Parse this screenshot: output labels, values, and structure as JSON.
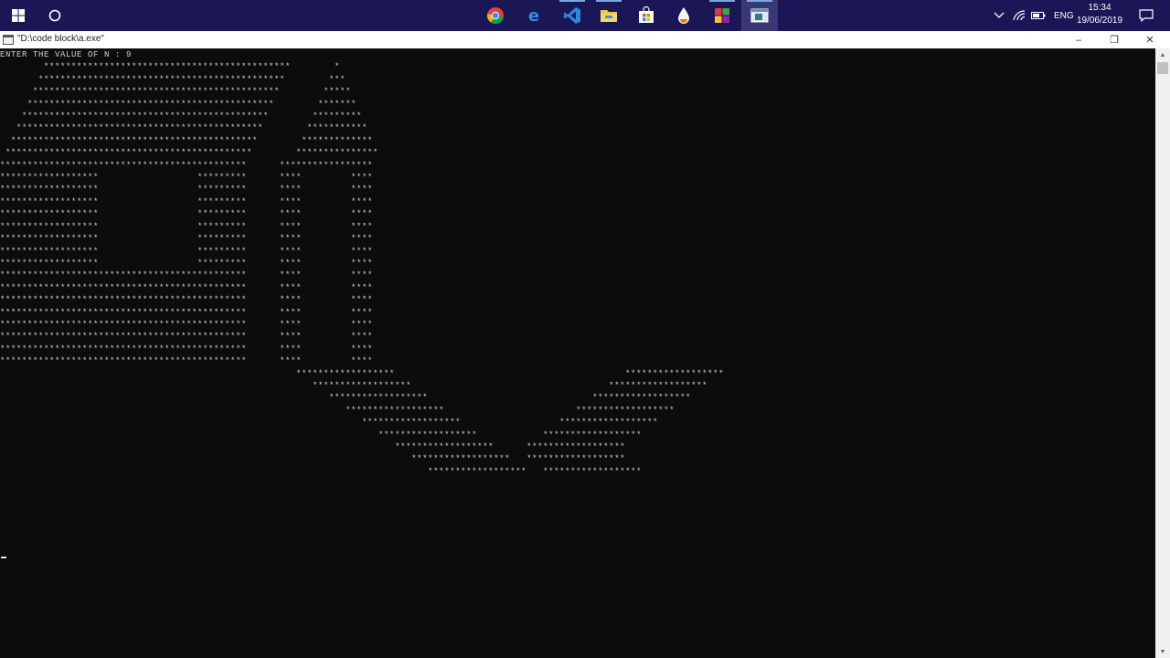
{
  "taskbar": {
    "apps": [
      {
        "icon": "chrome-icon",
        "running": false
      },
      {
        "icon": "edge-icon",
        "running": false
      },
      {
        "icon": "vscode-icon",
        "running": true
      },
      {
        "icon": "file-explorer-icon",
        "running": true
      },
      {
        "icon": "store-icon",
        "running": false
      },
      {
        "icon": "drop-app-icon",
        "running": false
      },
      {
        "icon": "codeblocks-icon",
        "running": true
      },
      {
        "icon": "console-app-icon",
        "running": true
      }
    ],
    "language": "ENG",
    "time": "15:34",
    "date": "19/06/2019"
  },
  "window": {
    "title": "\"D:\\code block\\a.exe\"",
    "controls": {
      "minimize": "–",
      "maximize": "❐",
      "close": "✕"
    }
  },
  "console": {
    "prompt": "ENTER THE VALUE OF N : 9",
    "output": [
      "        *********************************************        *",
      "       *********************************************        ***",
      "      *********************************************        *****",
      "     *********************************************        *******",
      "    *********************************************        *********",
      "   *********************************************        ***********",
      "  *********************************************        *************",
      " *********************************************        ***************",
      "*********************************************      *****************",
      "******************                  *********      ****         ****",
      "******************                  *********      ****         ****",
      "******************                  *********      ****         ****",
      "******************                  *********      ****         ****",
      "******************                  *********      ****         ****",
      "******************                  *********      ****         ****",
      "******************                  *********      ****         ****",
      "******************                  *********      ****         ****",
      "*********************************************      ****         ****",
      "*********************************************      ****         ****",
      "*********************************************      ****         ****",
      "*********************************************      ****         ****",
      "*********************************************      ****         ****",
      "*********************************************      ****         ****",
      "*********************************************      ****         ****",
      "*********************************************      ****         ****",
      "                                                      ******************                                          ******************",
      "                                                         ******************                                    ******************",
      "                                                            ******************                              ******************",
      "                                                               ******************                        ******************",
      "                                                                  ******************                  ******************",
      "                                                                     ******************            ******************",
      "                                                                        ******************      ******************",
      "                                                                           ******************   ******************",
      "                                                                              ******************   ******************"
    ]
  }
}
